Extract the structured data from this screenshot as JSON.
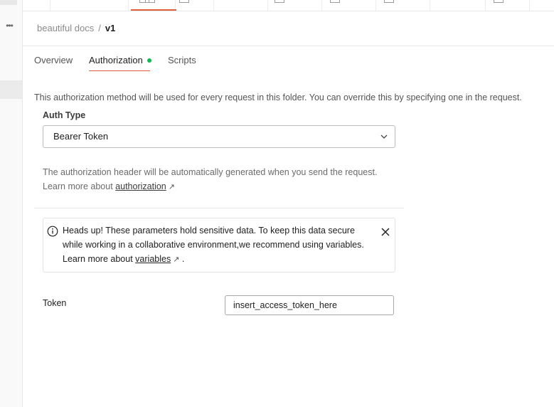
{
  "sidebar": {
    "more_icon": "more-horizontal-icon",
    "more_glyph": "•••"
  },
  "breadcrumb": {
    "parent": "beautiful docs",
    "separator": "/",
    "current": "v1"
  },
  "tabs": [
    {
      "label": "Overview"
    },
    {
      "label": "Authorization",
      "indicator_color": "#0cbb52"
    },
    {
      "label": "Scripts"
    }
  ],
  "active_tab": "Authorization",
  "accent_color": "#e0613a",
  "authorization": {
    "description": "This authorization method will be used for every request in this folder. You can override this by specifying one in the request.",
    "auth_type_label": "Auth Type",
    "auth_type_value": "Bearer Token",
    "help_text": "The authorization header will be automatically generated when you send the request.",
    "learn_more_prefix": "Learn more about",
    "learn_more_link": "authorization",
    "link_arrow": "↗"
  },
  "alert": {
    "icon": "info-icon",
    "text": "Heads up! These parameters hold sensitive data. To keep this data secure while working in a collaborative environment,we recommend using variables.",
    "learn_more_prefix": "Learn more about",
    "learn_more_link": "variables",
    "link_arrow": "↗",
    "suffix": "."
  },
  "token": {
    "label": "Token",
    "value": "insert_access_token_here"
  }
}
